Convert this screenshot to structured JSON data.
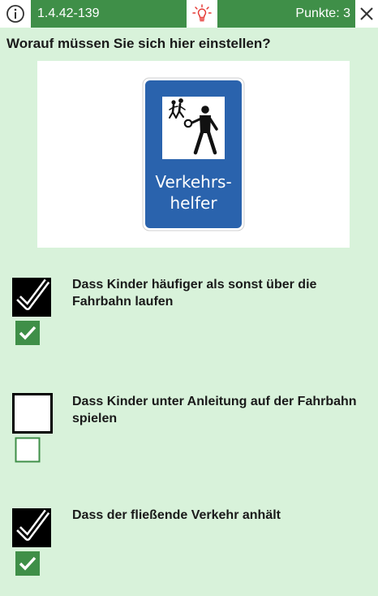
{
  "header": {
    "question_id": "1.4.42-139",
    "score_label": "Punkte: 3"
  },
  "question": {
    "text": "Worauf müssen Sie sich hier einstellen?",
    "sign": {
      "line1": "Verkehrs-",
      "line2": "helfer",
      "sign_color": "#2a63ad"
    }
  },
  "answers": [
    {
      "text": "Dass Kinder häufiger als sonst über die Fahrbahn laufen",
      "user_checked": true,
      "correct": true
    },
    {
      "text": "Dass Kinder unter Anleitung auf der Fahrbahn spielen",
      "user_checked": false,
      "correct": false
    },
    {
      "text": "Dass der fließende Verkehr anhält",
      "user_checked": true,
      "correct": true
    }
  ],
  "colors": {
    "accent_green": "#3f8f48",
    "background": "#d8f2da",
    "hint_icon": "#e53935"
  },
  "icons": {
    "info": "info-icon",
    "hint": "lightbulb-icon",
    "close": "close-icon"
  }
}
